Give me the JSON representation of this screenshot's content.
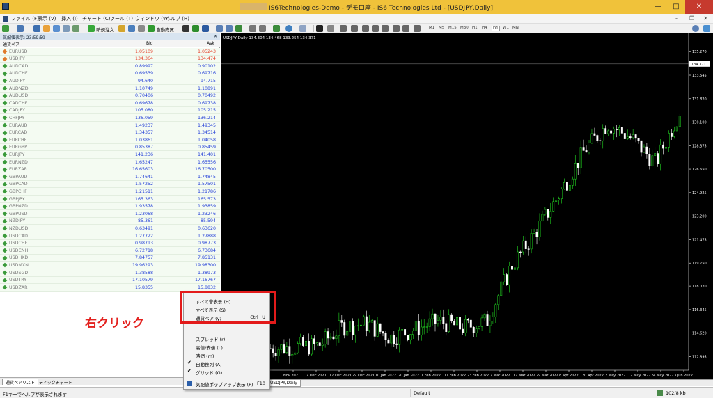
{
  "window": {
    "title": "IS6Technologies-Demo - デモ口座 - IS6 Technologies Ltd - [USDJPY,Daily]",
    "min": "—",
    "max": "□",
    "close": "✕"
  },
  "menu": [
    "ファイル (F)",
    "表示 (V)",
    "挿入 (I)",
    "チャート (C)",
    "ツール (T)",
    "ウィンドウ (W)",
    "ヘルプ (H)"
  ],
  "toolbar": {
    "new_order": "新規注文",
    "auto_trade": "自動売買",
    "timeframes": [
      "M1",
      "M5",
      "M15",
      "M30",
      "H1",
      "H4",
      "D1",
      "W1",
      "MN"
    ]
  },
  "market_watch": {
    "title": "気配値表示: 23:59:59",
    "col_symbol": "通貨ペア",
    "col_bid": "Bid",
    "col_ask": "Ask",
    "rows": [
      {
        "s": "EURUSD",
        "b": "1.05109",
        "a": "1.05243",
        "dir": "down"
      },
      {
        "s": "USDJPY",
        "b": "134.364",
        "a": "134.474",
        "dir": "down"
      },
      {
        "s": "AUDCAD",
        "b": "0.89997",
        "a": "0.90102",
        "dir": "up"
      },
      {
        "s": "AUDCHF",
        "b": "0.69539",
        "a": "0.69716",
        "dir": "up"
      },
      {
        "s": "AUDJPY",
        "b": "94.640",
        "a": "94.715",
        "dir": "up"
      },
      {
        "s": "AUDNZD",
        "b": "1.10749",
        "a": "1.10891",
        "dir": "up"
      },
      {
        "s": "AUDUSD",
        "b": "0.70406",
        "a": "0.70492",
        "dir": "up"
      },
      {
        "s": "CADCHF",
        "b": "0.69678",
        "a": "0.69738",
        "dir": "up"
      },
      {
        "s": "CADJPY",
        "b": "105.080",
        "a": "105.215",
        "dir": "up"
      },
      {
        "s": "CHFJPY",
        "b": "136.059",
        "a": "136.214",
        "dir": "up"
      },
      {
        "s": "EURAUD",
        "b": "1.49237",
        "a": "1.49345",
        "dir": "up"
      },
      {
        "s": "EURCAD",
        "b": "1.34357",
        "a": "1.34514",
        "dir": "up"
      },
      {
        "s": "EURCHF",
        "b": "1.03861",
        "a": "1.04058",
        "dir": "up"
      },
      {
        "s": "EURGBP",
        "b": "0.85387",
        "a": "0.85459",
        "dir": "up"
      },
      {
        "s": "EURJPY",
        "b": "141.236",
        "a": "141.401",
        "dir": "up"
      },
      {
        "s": "EURNZD",
        "b": "1.65247",
        "a": "1.65556",
        "dir": "up"
      },
      {
        "s": "EURZAR",
        "b": "16.65603",
        "a": "16.70500",
        "dir": "up"
      },
      {
        "s": "GBPAUD",
        "b": "1.74641",
        "a": "1.74845",
        "dir": "up"
      },
      {
        "s": "GBPCAD",
        "b": "1.57252",
        "a": "1.57501",
        "dir": "up"
      },
      {
        "s": "GBPCHF",
        "b": "1.21511",
        "a": "1.21786",
        "dir": "up"
      },
      {
        "s": "GBPJPY",
        "b": "165.363",
        "a": "165.573",
        "dir": "up"
      },
      {
        "s": "GBPNZD",
        "b": "1.93578",
        "a": "1.93859",
        "dir": "up"
      },
      {
        "s": "GBPUSD",
        "b": "1.23068",
        "a": "1.23246",
        "dir": "up"
      },
      {
        "s": "NZDJPY",
        "b": "85.361",
        "a": "85.594",
        "dir": "up"
      },
      {
        "s": "NZDUSD",
        "b": "0.63491",
        "a": "0.63620",
        "dir": "up"
      },
      {
        "s": "USDCAD",
        "b": "1.27722",
        "a": "1.27888",
        "dir": "up"
      },
      {
        "s": "USDCHF",
        "b": "0.98713",
        "a": "0.98773",
        "dir": "up"
      },
      {
        "s": "USDCNH",
        "b": "6.72718",
        "a": "6.73684",
        "dir": "up"
      },
      {
        "s": "USDHKD",
        "b": "7.84757",
        "a": "7.85131",
        "dir": "up"
      },
      {
        "s": "USDMXN",
        "b": "19.96293",
        "a": "19.98300",
        "dir": "up"
      },
      {
        "s": "USDSGD",
        "b": "1.38588",
        "a": "1.38973",
        "dir": "up"
      },
      {
        "s": "USDTRY",
        "b": "17.10579",
        "a": "17.16767",
        "dir": "up"
      },
      {
        "s": "USDZAR",
        "b": "15.8355",
        "a": "15.8832",
        "dir": "up"
      }
    ],
    "tabs": [
      "通貨ペアリスト",
      "ティックチャート"
    ]
  },
  "chart": {
    "header": "USDJPY,Daily  134.304 134.468 133.254 134.371",
    "last_price": "134.371",
    "tab": "USDJPY,Daily",
    "y_ticks": [
      "135.270",
      "133.545",
      "131.820",
      "130.100",
      "128.375",
      "126.650",
      "124.925",
      "123.200",
      "121.475",
      "119.750",
      "118.070",
      "116.345",
      "114.620",
      "112.895"
    ],
    "x_ticks": [
      "Nov 2021",
      "7 Dec 2021",
      "17 Dec 2021",
      "29 Dec 2021",
      "10 Jan 2022",
      "20 Jan 2022",
      "1 Feb 2022",
      "11 Feb 2022",
      "23 Feb 2022",
      "7 Mar 2022",
      "17 Mar 2022",
      "29 Mar 2022",
      "8 Apr 2022",
      "20 Apr 2022",
      "2 May 2022",
      "12 May 2022",
      "24 May 2022",
      "3 Jun 2022"
    ],
    "up_color": "#22dd22",
    "down_color": "#ffffff"
  },
  "chart_data": {
    "type": "candlestick",
    "title": "USDJPY,Daily",
    "xlabel": "",
    "ylabel": "",
    "ylim": [
      112.0,
      136.2
    ],
    "x": [
      "Nov 2021",
      "7 Dec 2021",
      "17 Dec 2021",
      "29 Dec 2021",
      "10 Jan 2022",
      "20 Jan 2022",
      "1 Feb 2022",
      "11 Feb 2022",
      "23 Feb 2022",
      "7 Mar 2022",
      "17 Mar 2022",
      "29 Mar 2022",
      "8 Apr 2022",
      "20 Apr 2022",
      "2 May 2022",
      "12 May 2022",
      "24 May 2022",
      "3 Jun 2022"
    ],
    "close": [
      113.5,
      113.6,
      113.7,
      115.1,
      115.3,
      114.3,
      114.9,
      115.5,
      115.0,
      115.5,
      119.5,
      122.0,
      124.8,
      127.9,
      130.0,
      128.9,
      127.1,
      130.9
    ],
    "last": 134.371
  },
  "context_menu": {
    "items": [
      {
        "label": "すべて非表示 (H)",
        "shortcut": "",
        "check": ""
      },
      {
        "label": "すべて表示 (S)",
        "shortcut": "",
        "check": ""
      },
      {
        "label": "通貨ペア (y)",
        "shortcut": "Ctrl+U",
        "check": ""
      },
      {
        "label": "スプレッド (r)",
        "shortcut": "",
        "check": ""
      },
      {
        "label": "高値/安値 (L)",
        "shortcut": "",
        "check": ""
      },
      {
        "label": "時間 (m)",
        "shortcut": "",
        "check": ""
      },
      {
        "label": "自動整列 (A)",
        "shortcut": "",
        "check": "✔"
      },
      {
        "label": "グリッド (G)",
        "shortcut": "",
        "check": "✔"
      },
      {
        "label": "気配値ポップアップ表示 (P)",
        "shortcut": "F10",
        "check": ""
      }
    ]
  },
  "annotation": "右クリック",
  "status": {
    "help": "F1キーでヘルプが表示されます",
    "profile": "Default",
    "traffic": "102/8 kb"
  }
}
